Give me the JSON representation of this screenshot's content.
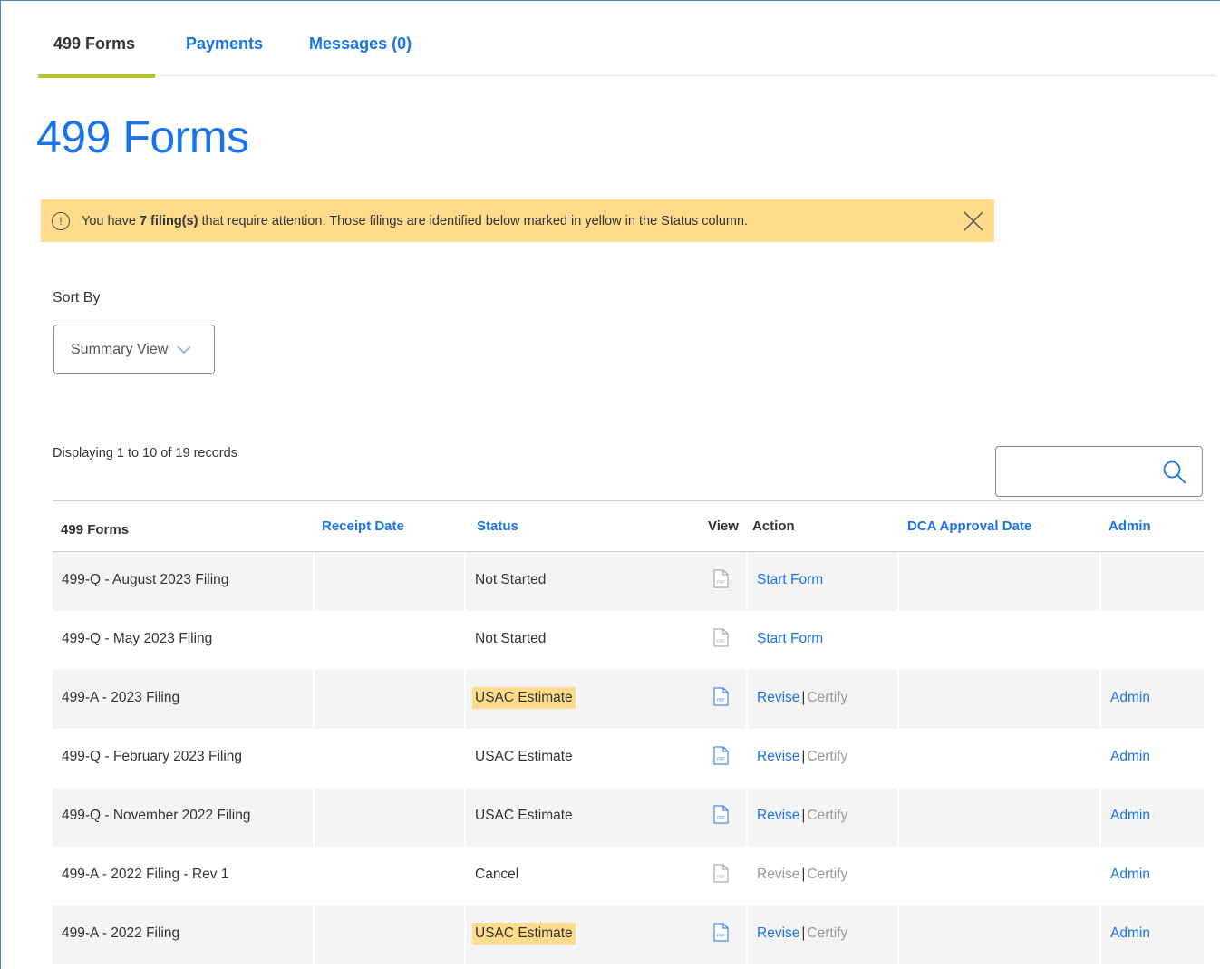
{
  "tabs": [
    {
      "label": "499 Forms",
      "active": true
    },
    {
      "label": "Payments",
      "active": false
    },
    {
      "label": "Messages (0)",
      "active": false
    }
  ],
  "page_title": "499 Forms",
  "alert": {
    "prefix": "You have ",
    "bold": "7 filing(s)",
    "suffix": " that require attention. Those filings are identified below marked in yellow in the Status column.",
    "icon": "info-circle-icon",
    "close_icon": "close-icon"
  },
  "sort": {
    "label": "Sort By",
    "selected": "Summary View"
  },
  "records_text": "Displaying 1 to 10 of 19 records",
  "search": {
    "placeholder": "",
    "value": ""
  },
  "columns": {
    "forms": "499 Forms",
    "receipt": "Receipt Date",
    "status": "Status",
    "view": "View",
    "action": "Action",
    "dca": "DCA Approval Date",
    "admin": "Admin"
  },
  "colors": {
    "accent": "#1a73e8",
    "warning": "#fedc8c",
    "tab_underline": "#b5c42a"
  },
  "rows": [
    {
      "form": "499-Q - August 2023 Filing",
      "status": "Not Started",
      "highlight": false,
      "pdf_active": false,
      "action_a": "Start Form",
      "action_b": "",
      "a_enabled": true,
      "b_enabled": false,
      "admin": ""
    },
    {
      "form": "499-Q - May 2023 Filing",
      "status": "Not Started",
      "highlight": false,
      "pdf_active": false,
      "action_a": "Start Form",
      "action_b": "",
      "a_enabled": true,
      "b_enabled": false,
      "admin": ""
    },
    {
      "form": "499-A - 2023 Filing",
      "status": "USAC Estimate",
      "highlight": true,
      "pdf_active": true,
      "action_a": "Revise",
      "action_b": "Certify",
      "a_enabled": true,
      "b_enabled": false,
      "admin": "Admin"
    },
    {
      "form": "499-Q - February 2023 Filing",
      "status": "USAC Estimate",
      "highlight": false,
      "pdf_active": true,
      "action_a": "Revise",
      "action_b": "Certify",
      "a_enabled": true,
      "b_enabled": false,
      "admin": "Admin"
    },
    {
      "form": "499-Q - November 2022 Filing",
      "status": "USAC Estimate",
      "highlight": false,
      "pdf_active": true,
      "action_a": "Revise",
      "action_b": "Certify",
      "a_enabled": true,
      "b_enabled": false,
      "admin": "Admin"
    },
    {
      "form": "499-A - 2022 Filing - Rev 1",
      "status": "Cancel",
      "highlight": false,
      "pdf_active": false,
      "action_a": "Revise",
      "action_b": "Certify",
      "a_enabled": false,
      "b_enabled": false,
      "admin": "Admin"
    },
    {
      "form": "499-A - 2022 Filing",
      "status": "USAC Estimate",
      "highlight": true,
      "pdf_active": true,
      "action_a": "Revise",
      "action_b": "Certify",
      "a_enabled": true,
      "b_enabled": false,
      "admin": "Admin"
    }
  ]
}
